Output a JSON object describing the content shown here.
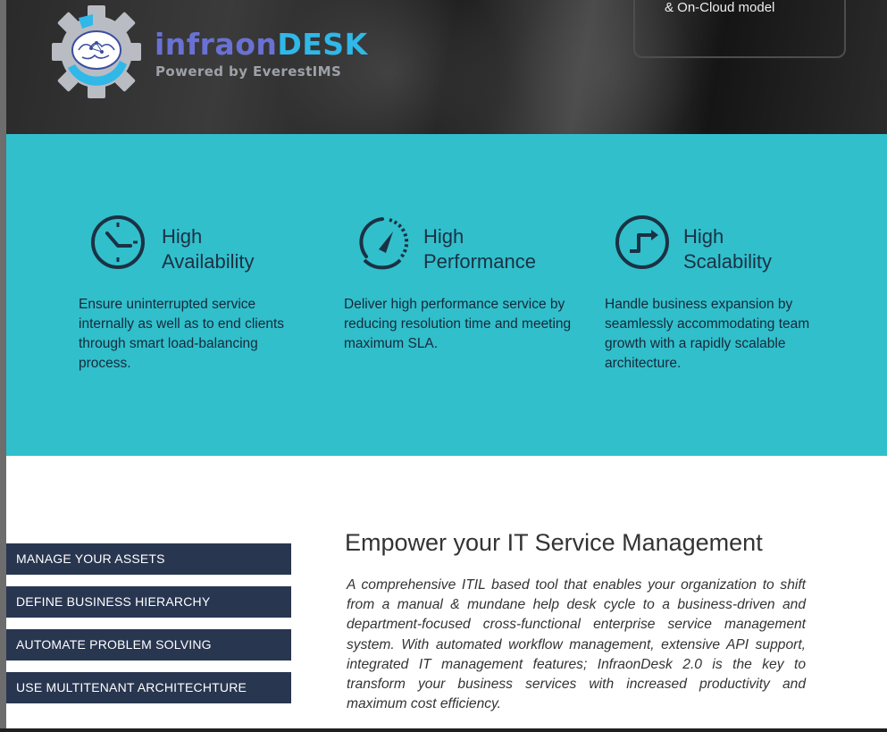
{
  "header": {
    "brand_part1": "infraon",
    "brand_part2": "DESK",
    "powered_by": "Powered by EverestIMS",
    "cloud_text": "& On-Cloud model"
  },
  "features": [
    {
      "title_line1": "High",
      "title_line2": "Availability",
      "icon": "clock-icon",
      "description": "Ensure uninterrupted service internally as well as to end clients through smart load-balancing process."
    },
    {
      "title_line1": "High",
      "title_line2": "Performance",
      "icon": "speedometer-icon",
      "description": "Deliver high performance service by reducing resolution time and meeting maximum SLA."
    },
    {
      "title_line1": "High",
      "title_line2": "Scalability",
      "icon": "step-arrow-icon",
      "description": "Handle business expansion by seamlessly accommodating team growth with a rapidly scalable architecture."
    }
  ],
  "nav_buttons": [
    "MANAGE YOUR ASSETS",
    "DEFINE BUSINESS HIERARCHY",
    "AUTOMATE PROBLEM SOLVING",
    "USE MULTITENANT ARCHITECHTURE"
  ],
  "main": {
    "heading": "Empower your IT Service Management",
    "paragraph": "A comprehensive ITIL based tool that enables your organization to shift from a manual & mundane help desk cycle to a business-driven and department-focused cross-functional enterprise service management system. With automated workflow management, extensive API support, integrated IT management features; InfraonDesk 2.0 is the key to transform your business services with increased productivity and maximum cost efficiency."
  },
  "colors": {
    "teal_band": "#31bfcb",
    "nav_button": "#283650",
    "icon_stroke": "#1b3144",
    "brand_purple": "#6a71d4",
    "brand_blue": "#2fb8e8"
  }
}
